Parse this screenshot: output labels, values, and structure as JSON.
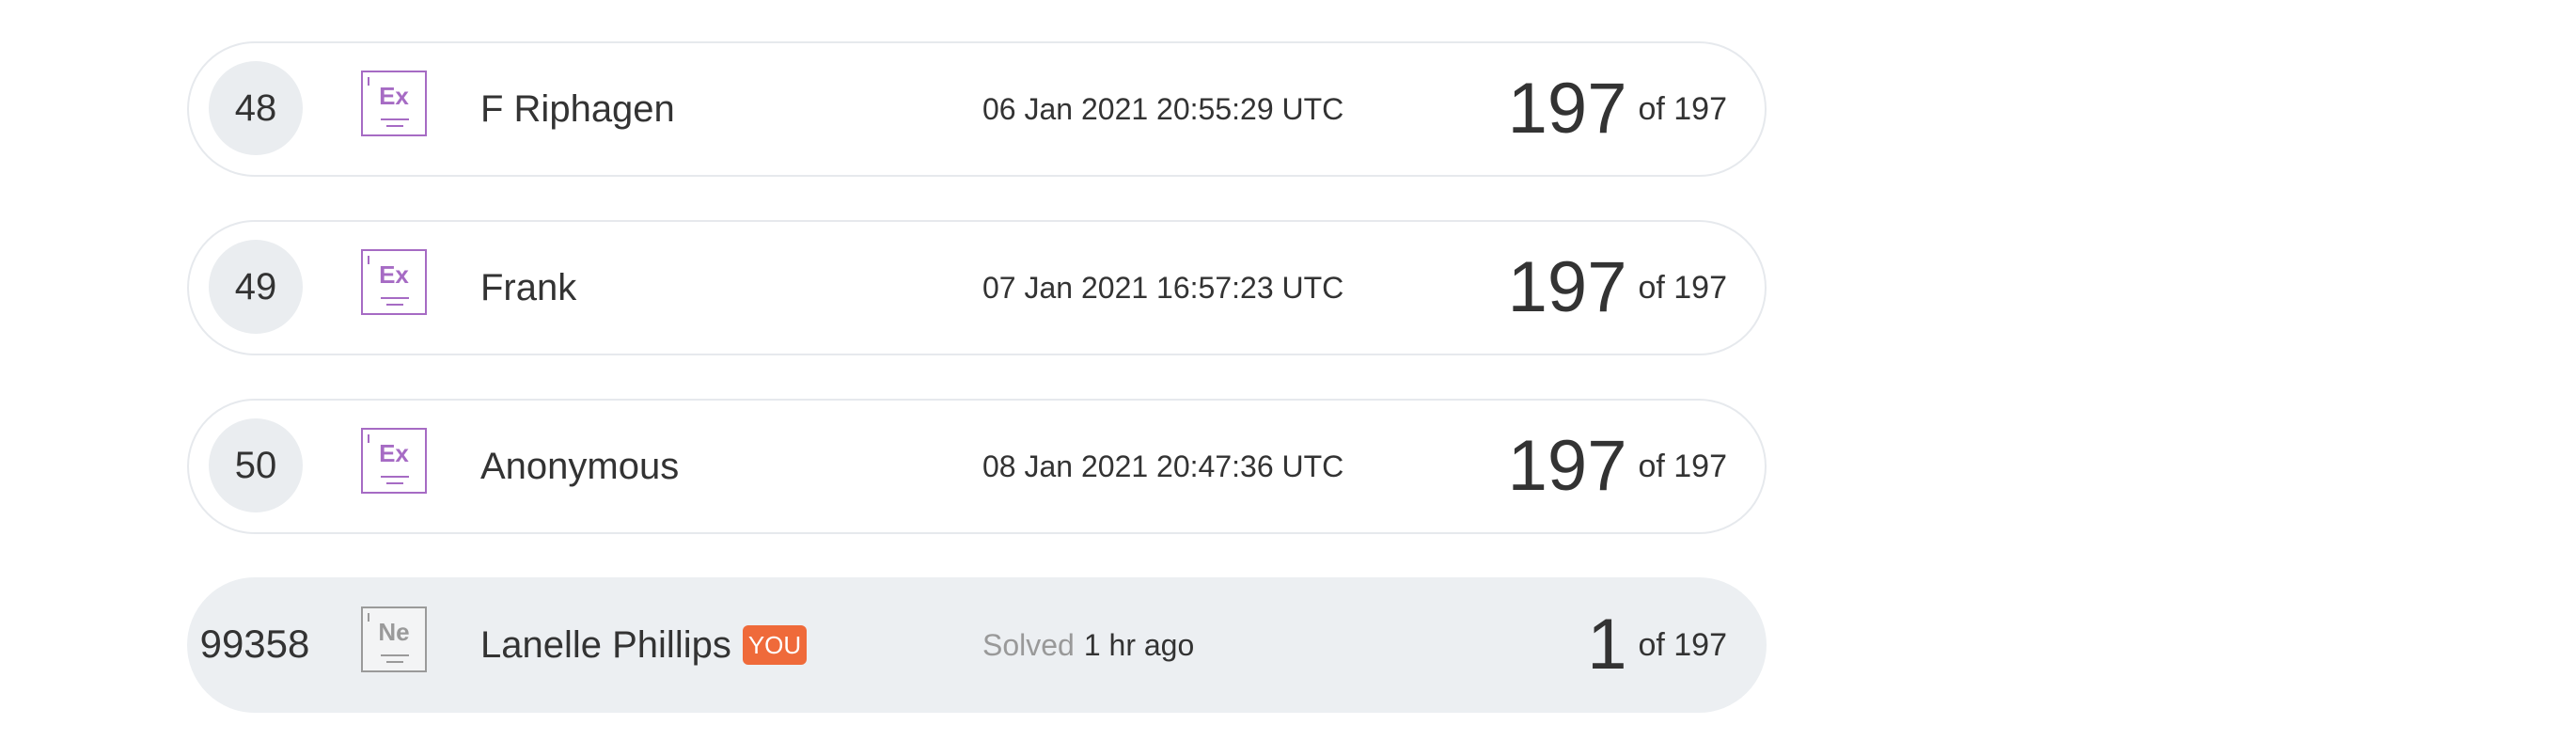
{
  "leaderboard": {
    "rows": [
      {
        "rank": "48",
        "level_symbol": "Ex",
        "name": "F Riphagen",
        "solved_at": "06 Jan 2021 20:55:29 UTC",
        "score": "197",
        "total": "of 197"
      },
      {
        "rank": "49",
        "level_symbol": "Ex",
        "name": "Frank",
        "solved_at": "07 Jan 2021 16:57:23 UTC",
        "score": "197",
        "total": "of 197"
      },
      {
        "rank": "50",
        "level_symbol": "Ex",
        "name": "Anonymous",
        "solved_at": "08 Jan 2021 20:47:36 UTC",
        "score": "197",
        "total": "of 197"
      }
    ],
    "current_user": {
      "rank": "99358",
      "level_symbol": "Ne",
      "name": "Lanelle Phillips",
      "badge": "YOU",
      "solved_prefix": "Solved",
      "solved_at": "1 hr ago",
      "score": "1",
      "total": "of 197"
    }
  },
  "colors": {
    "expert_level": "#a66bc4",
    "new_level": "#9a9a9a",
    "you_badge": "#ef6a3a",
    "current_row_bg": "#eceff2",
    "row_border": "#e6e9ed"
  },
  "icons": {
    "expert_level": "expert-level-icon",
    "new_level": "new-level-icon"
  }
}
